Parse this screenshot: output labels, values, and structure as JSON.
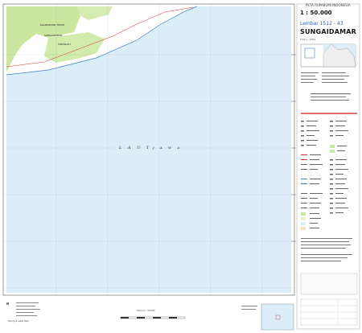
{
  "header": {
    "series": "PETA RUPABUMI INDONESIA",
    "scale": "1 : 50.000",
    "sheet": "Lembar 1512 - 43",
    "title": "SUNGAIDAMAR",
    "edition": "Edisi I - 2001"
  },
  "map": {
    "places": {
      "province": "KALIMANTAN TIMUR",
      "village1": "SUNGAIDAMAR",
      "village2": "TAPUSLAH"
    },
    "sea": {
      "word1": "L A U T",
      "word2": "J A W A"
    }
  },
  "footer": {
    "scale_label": "SKALA 1 : 50.000",
    "left_note": "Petunjuk Letak Peta"
  },
  "colors": {
    "land": "#c9e79f",
    "water": "#dbeef8",
    "road": "#d23030",
    "text_blue": "#2b62b8"
  }
}
